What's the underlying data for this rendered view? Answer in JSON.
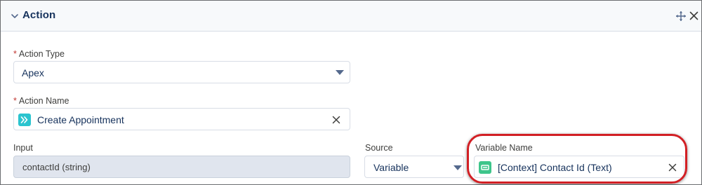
{
  "panel": {
    "title": "Action"
  },
  "fields": {
    "action_type": {
      "label": "Action Type",
      "required_mark": "*",
      "value": "Apex"
    },
    "action_name": {
      "label": "Action Name",
      "required_mark": "*",
      "value": "Create Appointment",
      "badge_icon": "apex-action-icon"
    },
    "input": {
      "label": "Input",
      "value": "contactId (string)"
    },
    "source": {
      "label": "Source",
      "value": "Variable"
    },
    "variable_name": {
      "label": "Variable Name",
      "value": "[Context] Contact Id (Text)",
      "badge_icon": "text-variable-icon"
    }
  },
  "colors": {
    "accent_teal": "#2bc4cf",
    "variable_green": "#3ec58b",
    "highlight_red": "#d21f24",
    "required_red": "#c23934"
  }
}
